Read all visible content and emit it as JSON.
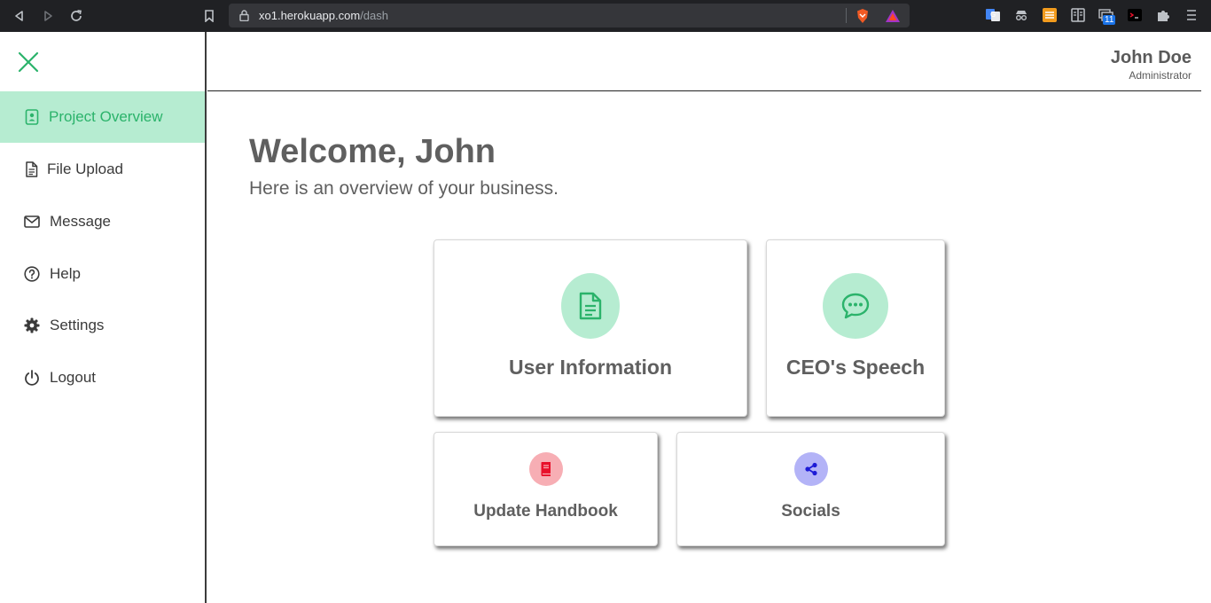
{
  "browser": {
    "url_host": "xo1.herokuapp.com",
    "url_path": "/dash",
    "ext_badge": "11"
  },
  "sidebar": {
    "items": [
      {
        "label": "Project Overview",
        "icon": "contact-card-icon"
      },
      {
        "label": "File Upload",
        "icon": "file-icon"
      },
      {
        "label": "Message",
        "icon": "envelope-icon"
      },
      {
        "label": "Help",
        "icon": "question-circle-icon"
      },
      {
        "label": "Settings",
        "icon": "gear-icon"
      },
      {
        "label": "Logout",
        "icon": "power-icon"
      }
    ],
    "accent_color": "#2bb36b",
    "active_bg": "#b6ecd1"
  },
  "header": {
    "user_name": "John Doe",
    "user_role": "Administrator"
  },
  "main": {
    "welcome": "Welcome, John",
    "subtitle": "Here is an overview of your business.",
    "cards": [
      {
        "label": "User Information",
        "icon": "document-icon",
        "color": "#2bb36b",
        "bg": "#b6ecd1"
      },
      {
        "label": "CEO's Speech",
        "icon": "chat-bubble-icon",
        "color": "#2bb36b",
        "bg": "#b6ecd1"
      },
      {
        "label": "Update Handbook",
        "icon": "book-icon",
        "color": "#e8102a",
        "bg": "#f7aeb4"
      },
      {
        "label": "Socials",
        "icon": "share-icon",
        "color": "#1d1bd6",
        "bg": "#b3b3f7"
      }
    ]
  }
}
